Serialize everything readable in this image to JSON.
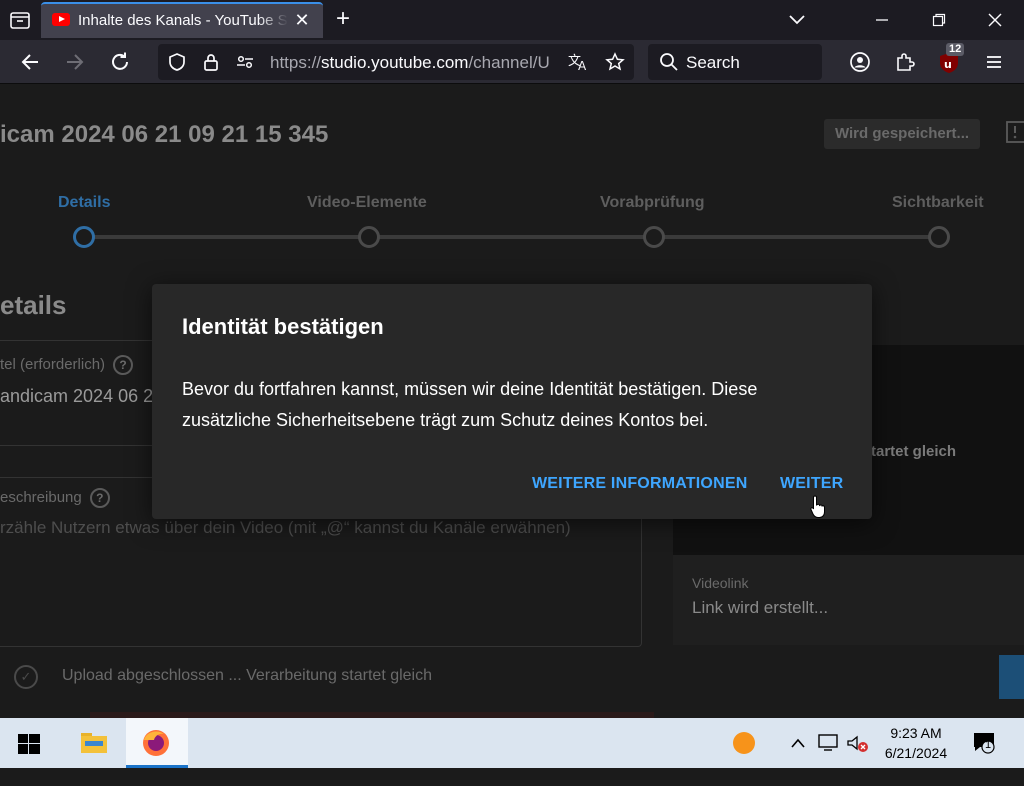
{
  "browser": {
    "tab_title": "Inhalte des Kanals - YouTube Studio",
    "url_domain": "studio.youtube.com",
    "url_prefix": "https://",
    "url_path": "/channel/U",
    "search_label": "Search",
    "extension_badge": "12"
  },
  "page": {
    "video_title": "icam 2024 06 21 09 21 15 345",
    "saving_label": "Wird gespeichert...",
    "steps": [
      "Details",
      "Video-Elemente",
      "Vorabprüfung",
      "Sichtbarkeit"
    ],
    "section_title": "etails",
    "title_field_label": "tel (erforderlich)",
    "title_field_value": "andicam 2024 06 2",
    "description_label": "eschreibung",
    "description_placeholder": "rzähle Nutzern etwas über dein Video (mit „@“ kannst du Kanäle erwähnen)",
    "side_status": "tartet gleich",
    "videolink_label": "Videolink",
    "videolink_value": "Link wird erstellt...",
    "upload_status": "Upload abgeschlossen ... Verarbeitung startet gleich"
  },
  "dialog": {
    "title": "Identität bestätigen",
    "body": "Bevor du fortfahren kannst, müssen wir deine Identität bestätigen. Diese zusätzliche Sicherheitsebene trägt zum Schutz deines Kontos bei.",
    "more_info_label": "WEITERE INFORMATIONEN",
    "continue_label": "WEITER"
  },
  "taskbar": {
    "time": "9:23 AM",
    "date": "6/21/2024",
    "notification_count": "1"
  },
  "colors": {
    "accent_blue": "#3ea6ff",
    "dialog_bg": "#282828",
    "browser_bg": "#2b2a33"
  }
}
